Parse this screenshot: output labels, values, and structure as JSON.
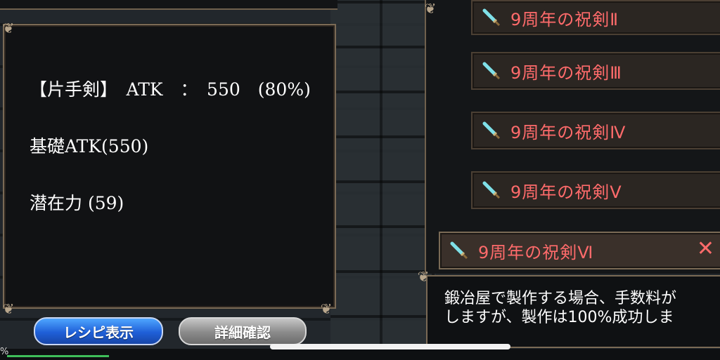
{
  "stats": {
    "line1": "【片手剣】　ATK　：　550　(80%)",
    "line2": "基礎ATK(550)",
    "line3": "潜在力 (59)"
  },
  "buttons": {
    "recipe": "レシピ表示",
    "details": "詳細確認"
  },
  "list": {
    "items": [
      {
        "label": "9周年の祝剣Ⅱ"
      },
      {
        "label": "9周年の祝剣Ⅲ"
      },
      {
        "label": "9周年の祝剣Ⅳ"
      },
      {
        "label": "9周年の祝剣Ⅴ"
      },
      {
        "label": "9周年の祝剣Ⅵ"
      }
    ],
    "selected_index": 4,
    "close_glyph": "✕"
  },
  "description": {
    "line1": "鍛冶屋で製作する場合、手数料が",
    "line2": "しますが、製作は100%成功しま"
  },
  "status": {
    "percent_glyph": "%"
  },
  "colors": {
    "item_text": "#ff6b6b",
    "primary_button": "#1f5fd8",
    "secondary_button": "#8a8a8a",
    "frame": "#7a6a55"
  },
  "icons": {
    "item_icon": "sword-icon",
    "close_icon": "close-icon"
  }
}
